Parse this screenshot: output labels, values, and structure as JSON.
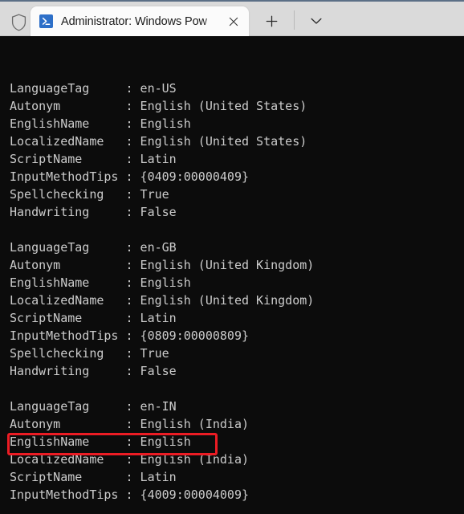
{
  "window": {
    "title": "Administrator: Windows PowerShell",
    "tab_title_truncated": "Administrator: Windows Pow",
    "background_color": "#0c0c0c",
    "text_color": "#cccccc",
    "titlebar_color": "#dadada",
    "accent_color": "#5b6f86"
  },
  "titlebar": {
    "shield_icon": "shield-icon",
    "tab_icon": "powershell-icon",
    "close_label": "✕",
    "new_tab_label": "+",
    "dropdown_label": "⌄"
  },
  "terminal": {
    "prompt_visible": false,
    "blocks": [
      {
        "highlighted": false,
        "rows": [
          {
            "key": "LanguageTag",
            "sep": ":",
            "value": "en-US"
          },
          {
            "key": "Autonym",
            "sep": ":",
            "value": "English (United States)"
          },
          {
            "key": "EnglishName",
            "sep": ":",
            "value": "English"
          },
          {
            "key": "LocalizedName",
            "sep": ":",
            "value": "English (United States)"
          },
          {
            "key": "ScriptName",
            "sep": ":",
            "value": "Latin"
          },
          {
            "key": "InputMethodTips",
            "sep": ":",
            "value": "{0409:00000409}"
          },
          {
            "key": "Spellchecking",
            "sep": ":",
            "value": "True"
          },
          {
            "key": "Handwriting",
            "sep": ":",
            "value": "False"
          }
        ]
      },
      {
        "highlighted": false,
        "rows": [
          {
            "key": "LanguageTag",
            "sep": ":",
            "value": "en-GB"
          },
          {
            "key": "Autonym",
            "sep": ":",
            "value": "English (United Kingdom)"
          },
          {
            "key": "EnglishName",
            "sep": ":",
            "value": "English"
          },
          {
            "key": "LocalizedName",
            "sep": ":",
            "value": "English (United Kingdom)"
          },
          {
            "key": "ScriptName",
            "sep": ":",
            "value": "Latin"
          },
          {
            "key": "InputMethodTips",
            "sep": ":",
            "value": "{0809:00000809}"
          },
          {
            "key": "Spellchecking",
            "sep": ":",
            "value": "True"
          },
          {
            "key": "Handwriting",
            "sep": ":",
            "value": "False"
          }
        ]
      },
      {
        "highlighted": true,
        "rows": [
          {
            "key": "LanguageTag",
            "sep": ":",
            "value": "en-IN"
          },
          {
            "key": "Autonym",
            "sep": ":",
            "value": "English (India)"
          },
          {
            "key": "EnglishName",
            "sep": ":",
            "value": "English"
          },
          {
            "key": "LocalizedName",
            "sep": ":",
            "value": "English (India)"
          },
          {
            "key": "ScriptName",
            "sep": ":",
            "value": "Latin"
          },
          {
            "key": "InputMethodTips",
            "sep": ":",
            "value": "{4009:00004009}"
          }
        ]
      }
    ]
  },
  "annotation": {
    "color": "#ec1c24",
    "target_text": "LanguageTag    : en-IN"
  }
}
